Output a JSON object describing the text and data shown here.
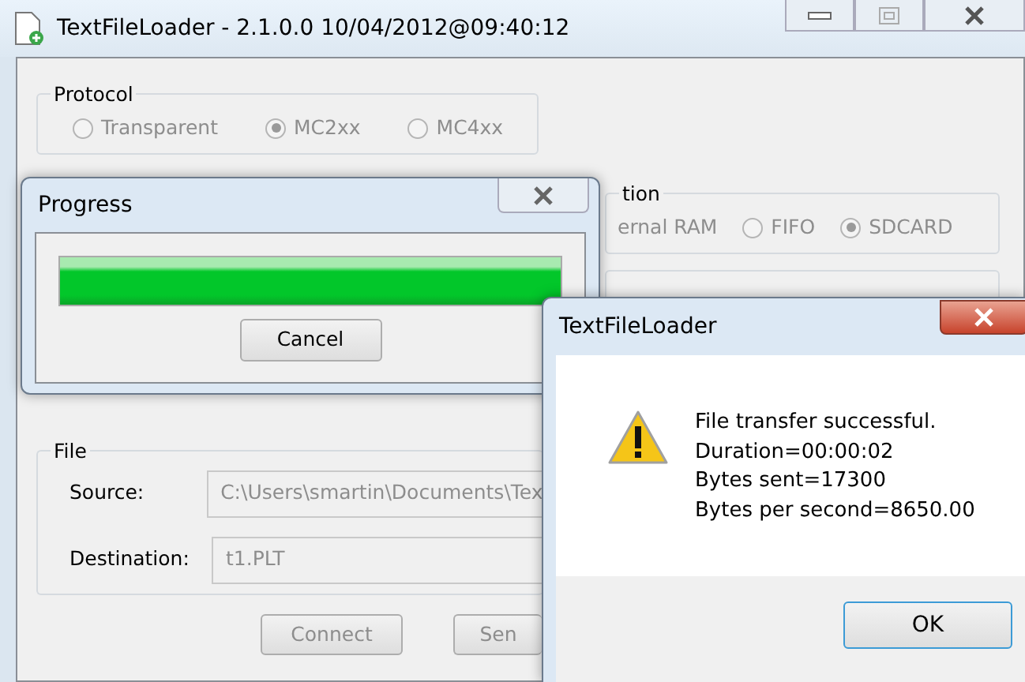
{
  "window": {
    "title": "TextFileLoader - 2.1.0.0 10/04/2012@09:40:12"
  },
  "protocol": {
    "title": "Protocol",
    "options": [
      {
        "label": "Transparent",
        "selected": false,
        "disabled": true
      },
      {
        "label": "MC2xx",
        "selected": true,
        "disabled": true
      },
      {
        "label": "MC4xx",
        "selected": false,
        "disabled": true
      }
    ]
  },
  "memory": {
    "title": "tion",
    "options": [
      {
        "label": "ernal RAM",
        "kind": "text",
        "disabled": true
      },
      {
        "label": "FIFO",
        "kind": "radio",
        "selected": false,
        "disabled": true
      },
      {
        "label": "SDCARD",
        "kind": "radio",
        "selected": true,
        "disabled": true
      }
    ]
  },
  "file": {
    "title": "File",
    "fields": [
      {
        "label": "Source:",
        "value": "C:\\Users\\smartin\\Documents\\Tex",
        "disabled": true
      },
      {
        "label": "Destination:",
        "value": "t1.PLT",
        "disabled": true
      }
    ]
  },
  "buttons": [
    {
      "label": "Connect",
      "disabled": true
    },
    {
      "label": "Sen",
      "disabled": true
    }
  ],
  "progress_dialog": {
    "title": "Progress",
    "level": 1.0,
    "cancel": "Cancel"
  },
  "message_box": {
    "title": "TextFileLoader",
    "lines": [
      "File transfer successful.",
      "Duration=00:00:02",
      "Bytes sent=17300",
      "Bytes per second=8650.00"
    ],
    "ok": "OK"
  }
}
